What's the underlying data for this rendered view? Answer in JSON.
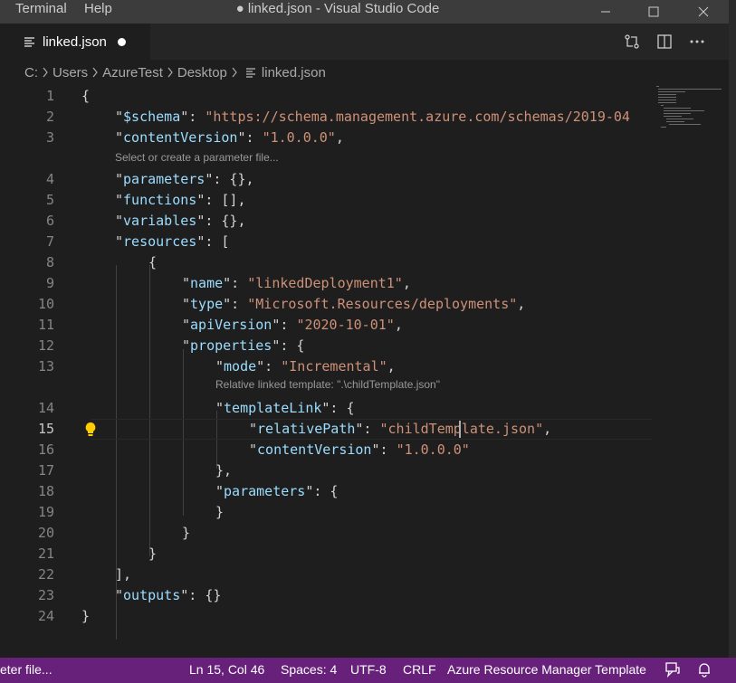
{
  "window": {
    "menus": [
      "Terminal",
      "Help"
    ],
    "title": "● linked.json - Visual Studio Code"
  },
  "tab": {
    "label": "linked.json"
  },
  "breadcrumb": [
    "C:",
    "Users",
    "AzureTest",
    "Desktop",
    "linked.json"
  ],
  "codelens": {
    "parameters": "Select or create a parameter file...",
    "relative": "Relative linked template: \".\\childTemplate.json\""
  },
  "code_lines": [
    {
      "n": "1",
      "indent": 0,
      "parts": [
        [
          "p",
          "{"
        ]
      ]
    },
    {
      "n": "2",
      "indent": 1,
      "parts": [
        [
          "p",
          "\""
        ],
        [
          "key",
          "$schema"
        ],
        [
          "p",
          "\": "
        ],
        [
          "str",
          "\"https://schema.management.azure.com/schemas/2019-04"
        ]
      ]
    },
    {
      "n": "3",
      "indent": 1,
      "parts": [
        [
          "p",
          "\""
        ],
        [
          "key",
          "contentVersion"
        ],
        [
          "p",
          "\": "
        ],
        [
          "str",
          "\"1.0.0.0\""
        ],
        [
          "p",
          ","
        ]
      ]
    },
    {
      "n": "4",
      "indent": 1,
      "parts": [
        [
          "p",
          "\""
        ],
        [
          "key",
          "parameters"
        ],
        [
          "p",
          "\": {},"
        ]
      ]
    },
    {
      "n": "5",
      "indent": 1,
      "parts": [
        [
          "p",
          "\""
        ],
        [
          "key",
          "functions"
        ],
        [
          "p",
          "\": [],"
        ]
      ]
    },
    {
      "n": "6",
      "indent": 1,
      "parts": [
        [
          "p",
          "\""
        ],
        [
          "key",
          "variables"
        ],
        [
          "p",
          "\": {},"
        ]
      ]
    },
    {
      "n": "7",
      "indent": 1,
      "parts": [
        [
          "p",
          "\""
        ],
        [
          "key",
          "resources"
        ],
        [
          "p",
          "\": ["
        ]
      ]
    },
    {
      "n": "8",
      "indent": 2,
      "parts": [
        [
          "p",
          "{"
        ]
      ]
    },
    {
      "n": "9",
      "indent": 3,
      "parts": [
        [
          "p",
          "\""
        ],
        [
          "key",
          "name"
        ],
        [
          "p",
          "\": "
        ],
        [
          "str",
          "\"linkedDeployment1\""
        ],
        [
          "p",
          ","
        ]
      ]
    },
    {
      "n": "10",
      "indent": 3,
      "parts": [
        [
          "p",
          "\""
        ],
        [
          "key",
          "type"
        ],
        [
          "p",
          "\": "
        ],
        [
          "str",
          "\"Microsoft.Resources/deployments\""
        ],
        [
          "p",
          ","
        ]
      ]
    },
    {
      "n": "11",
      "indent": 3,
      "parts": [
        [
          "p",
          "\""
        ],
        [
          "key",
          "apiVersion"
        ],
        [
          "p",
          "\": "
        ],
        [
          "str",
          "\"2020-10-01\""
        ],
        [
          "p",
          ","
        ]
      ]
    },
    {
      "n": "12",
      "indent": 3,
      "parts": [
        [
          "p",
          "\""
        ],
        [
          "key",
          "properties"
        ],
        [
          "p",
          "\": {"
        ]
      ]
    },
    {
      "n": "13",
      "indent": 4,
      "parts": [
        [
          "p",
          "\""
        ],
        [
          "key",
          "mode"
        ],
        [
          "p",
          "\": "
        ],
        [
          "str",
          "\"Incremental\""
        ],
        [
          "p",
          ","
        ]
      ]
    },
    {
      "n": "14",
      "indent": 4,
      "parts": [
        [
          "p",
          "\""
        ],
        [
          "key",
          "templateLink"
        ],
        [
          "p",
          "\": {"
        ]
      ]
    },
    {
      "n": "15",
      "indent": 5,
      "parts": [
        [
          "p",
          "\""
        ],
        [
          "key",
          "relativePath"
        ],
        [
          "p",
          "\": "
        ],
        [
          "str",
          "\"childTemplate.json\""
        ],
        [
          "p",
          ","
        ]
      ]
    },
    {
      "n": "16",
      "indent": 5,
      "parts": [
        [
          "p",
          "\""
        ],
        [
          "key",
          "contentVersion"
        ],
        [
          "p",
          "\": "
        ],
        [
          "str",
          "\"1.0.0.0\""
        ]
      ]
    },
    {
      "n": "17",
      "indent": 4,
      "parts": [
        [
          "p",
          "},"
        ]
      ]
    },
    {
      "n": "18",
      "indent": 4,
      "parts": [
        [
          "p",
          "\""
        ],
        [
          "key",
          "parameters"
        ],
        [
          "p",
          "\": {"
        ]
      ]
    },
    {
      "n": "19",
      "indent": 4,
      "parts": [
        [
          "p",
          "}"
        ]
      ]
    },
    {
      "n": "20",
      "indent": 3,
      "parts": [
        [
          "p",
          "}"
        ]
      ]
    },
    {
      "n": "21",
      "indent": 2,
      "parts": [
        [
          "p",
          "}"
        ]
      ]
    },
    {
      "n": "22",
      "indent": 1,
      "parts": [
        [
          "p",
          "],"
        ]
      ]
    },
    {
      "n": "23",
      "indent": 1,
      "parts": [
        [
          "p",
          "\""
        ],
        [
          "key",
          "outputs"
        ],
        [
          "p",
          "\": {}"
        ]
      ]
    },
    {
      "n": "24",
      "indent": 0,
      "parts": [
        [
          "p",
          "}"
        ]
      ]
    }
  ],
  "status": {
    "left": "eter file...",
    "position": "Ln 15, Col 46",
    "spaces": "Spaces: 4",
    "encoding": "UTF-8",
    "eol": "CRLF",
    "language": "Azure Resource Manager Template"
  },
  "colors": {
    "status_bg": "#68217a",
    "key": "#9cdcfe",
    "string": "#ce9178",
    "editor_bg": "#1e1e1e"
  },
  "icons": [
    "file-icon",
    "modified-dot-icon",
    "open-changes-icon",
    "split-editor-icon",
    "more-actions-icon",
    "lightbulb-icon",
    "feedback-icon",
    "bell-icon",
    "minimize-icon",
    "maximize-icon",
    "close-icon",
    "chevron-right-icon"
  ]
}
